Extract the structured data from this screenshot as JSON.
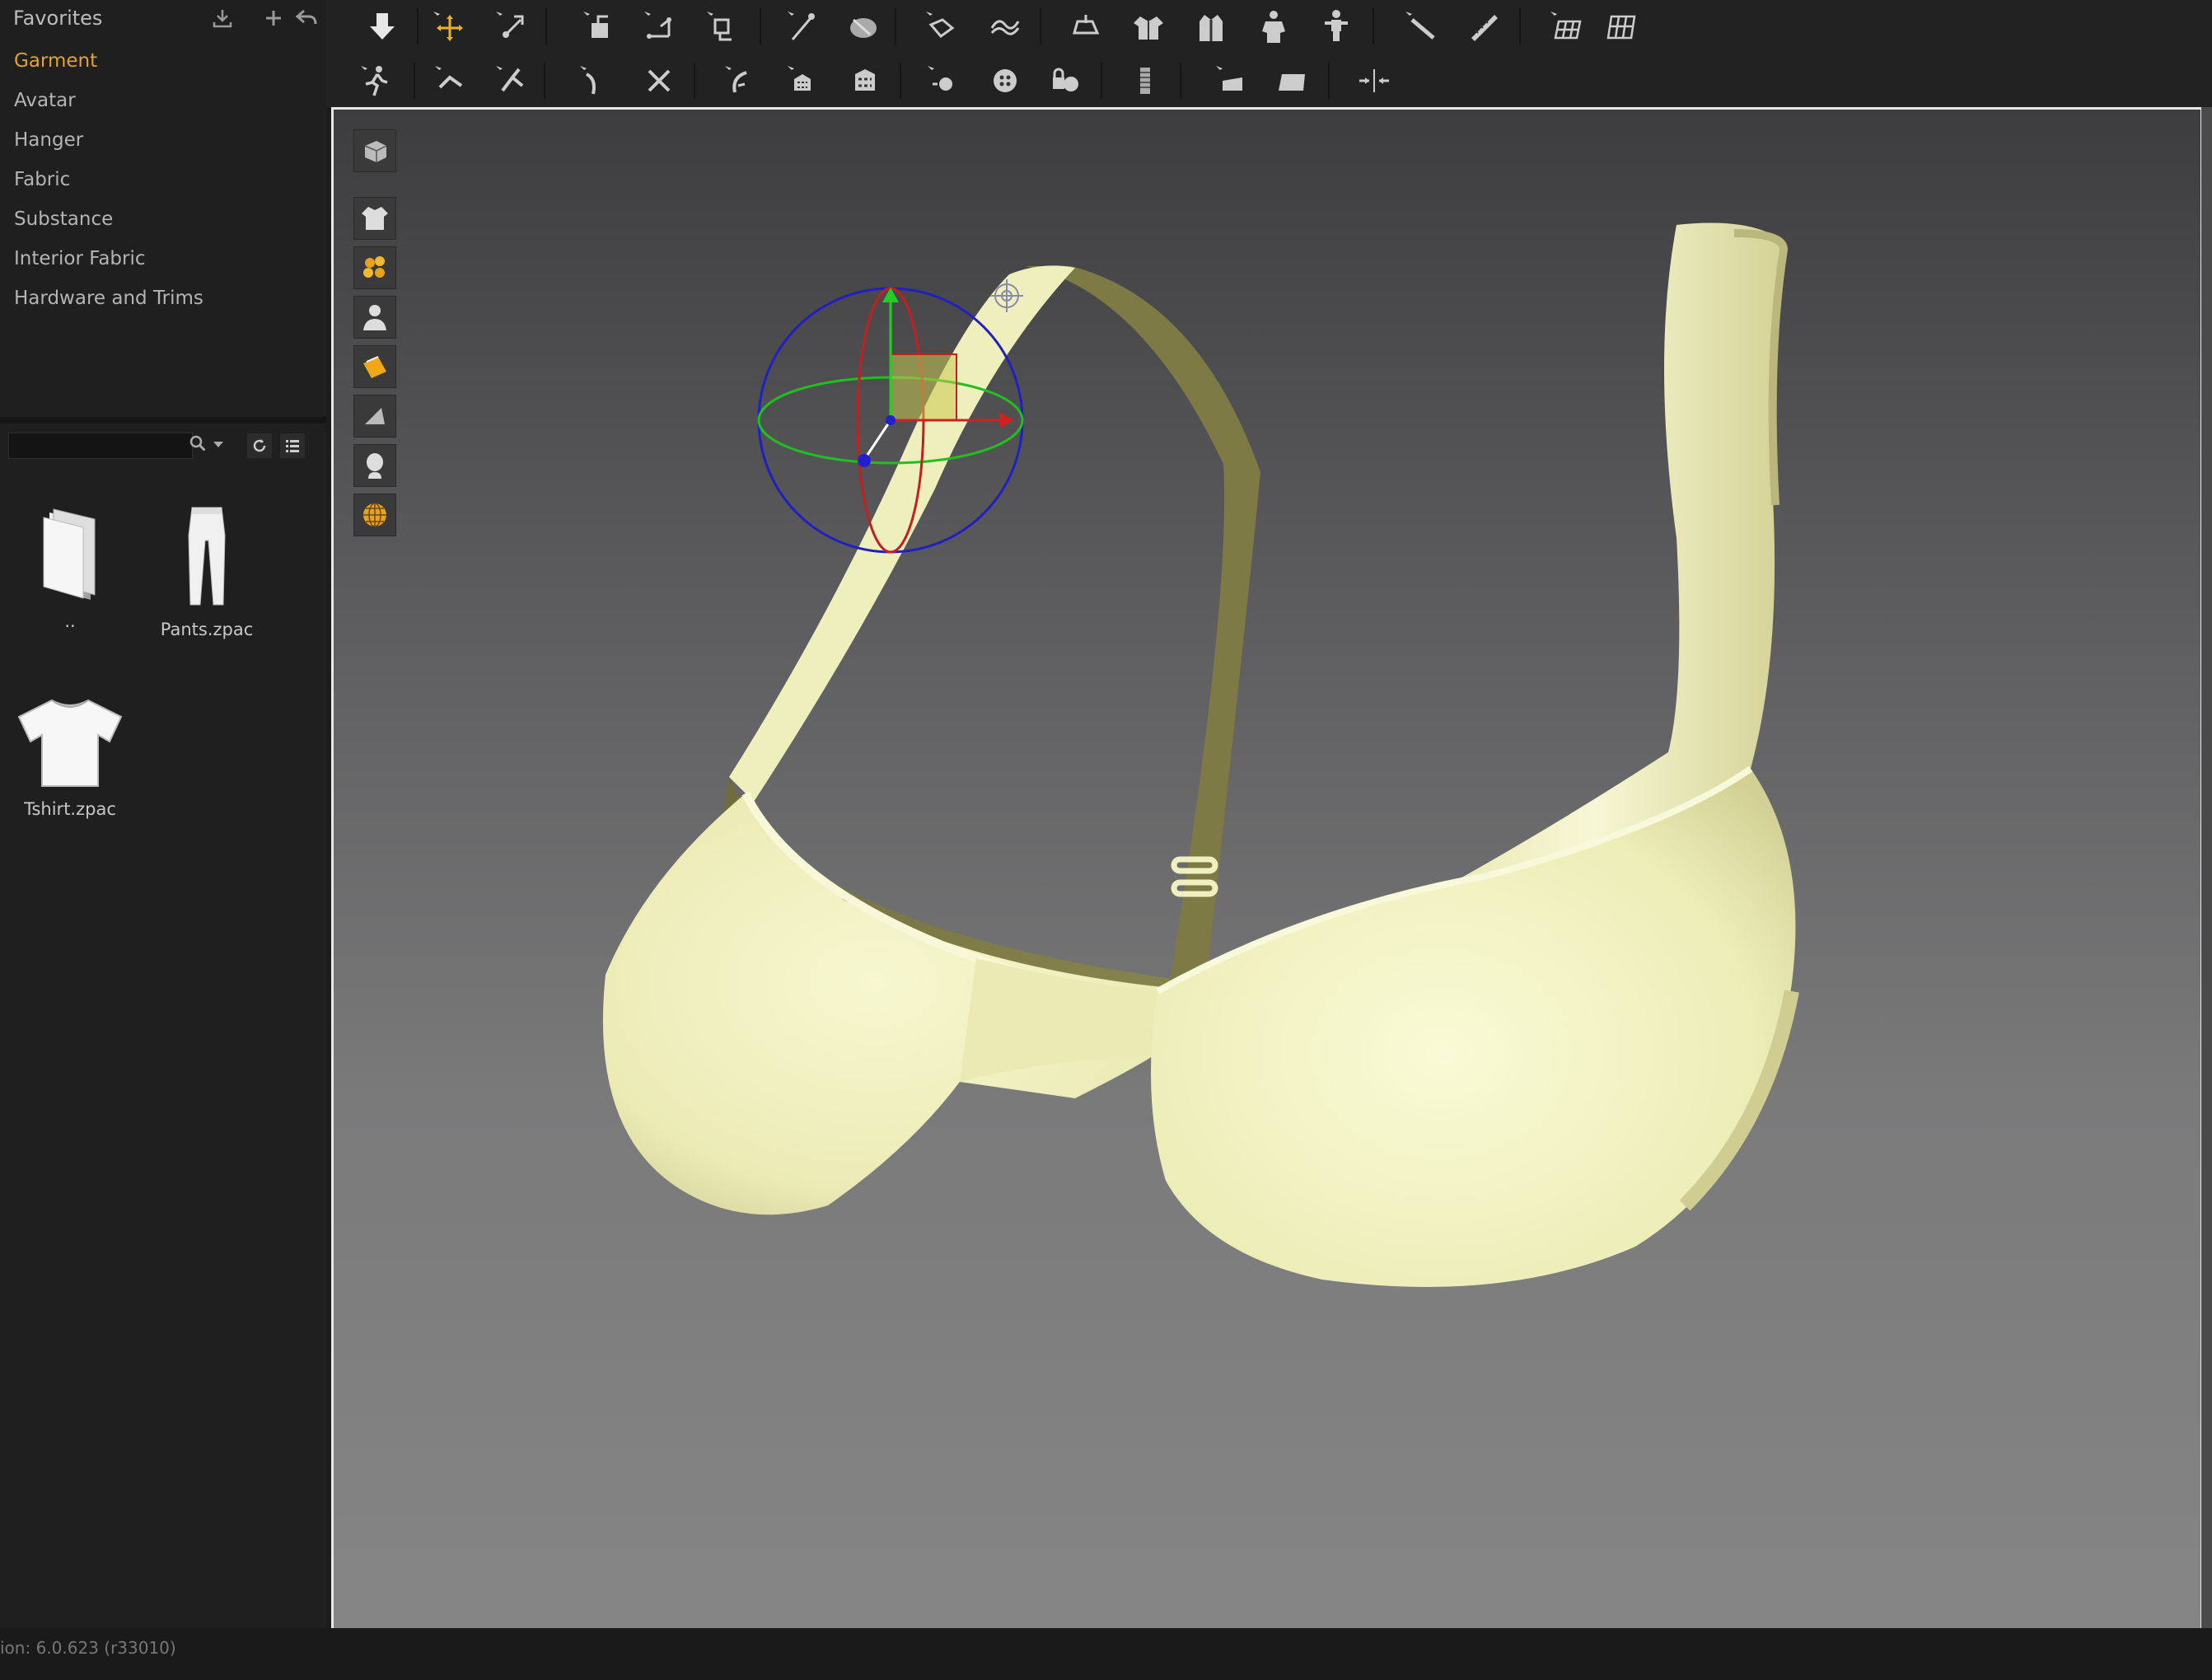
{
  "library": {
    "title": "Favorites",
    "items": [
      {
        "label": "Garment",
        "active": true
      },
      {
        "label": "Avatar",
        "active": false
      },
      {
        "label": "Hanger",
        "active": false
      },
      {
        "label": "Fabric",
        "active": false
      },
      {
        "label": "Substance",
        "active": false
      },
      {
        "label": "Interior Fabric",
        "active": false
      },
      {
        "label": "Hardware and Trims",
        "active": false
      }
    ],
    "accent_color": "#e0a230"
  },
  "browser": {
    "search_value": "",
    "files": [
      {
        "label": "..",
        "icon": "folder-icon"
      },
      {
        "label": "Pants.zpac",
        "icon": "pants-icon"
      },
      {
        "label": "Tshirt.zpac",
        "icon": "tshirt-icon"
      }
    ]
  },
  "status": {
    "version": "ion:  6.0.623 (r33010)"
  },
  "garment": {
    "color": "#efefb8",
    "shadow_color": "#7d7a45"
  }
}
